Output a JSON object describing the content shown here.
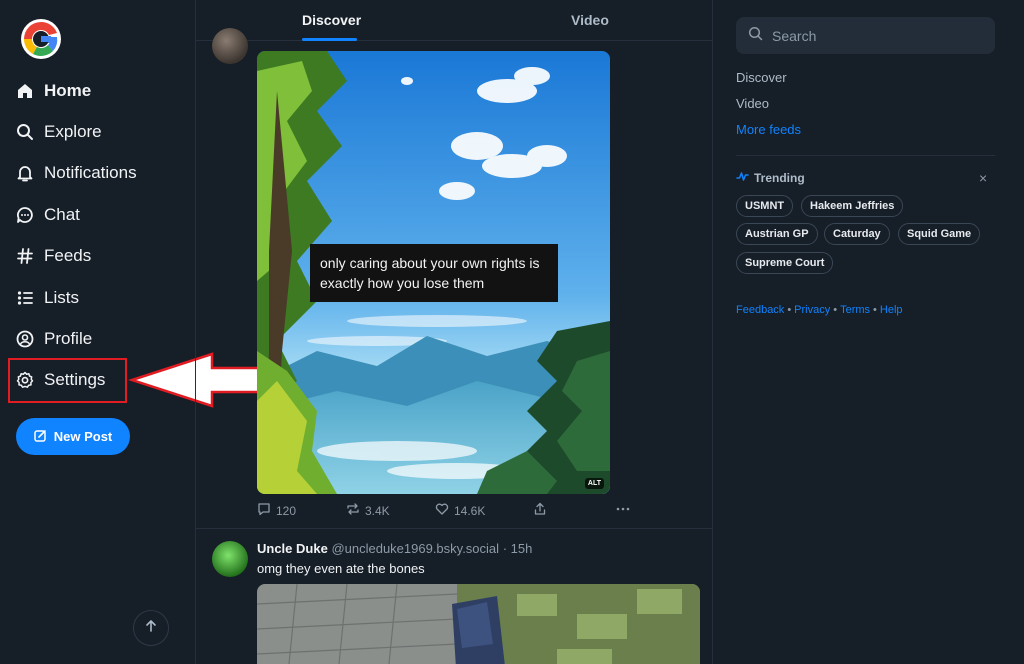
{
  "sidebar": {
    "nav": [
      {
        "label": "Home",
        "icon": "home-icon"
      },
      {
        "label": "Explore",
        "icon": "search-icon"
      },
      {
        "label": "Notifications",
        "icon": "bell-icon"
      },
      {
        "label": "Chat",
        "icon": "chat-bubble-icon"
      },
      {
        "label": "Feeds",
        "icon": "hash-icon"
      },
      {
        "label": "Lists",
        "icon": "list-icon"
      },
      {
        "label": "Profile",
        "icon": "user-circle-icon"
      },
      {
        "label": "Settings",
        "icon": "gear-icon"
      }
    ],
    "new_post_label": "New Post"
  },
  "feed": {
    "tabs": [
      "Discover",
      "Video"
    ],
    "active_tab": "Discover",
    "post1": {
      "image_caption": "only caring about your own rights is exactly how you lose them",
      "alt_badge": "ALT",
      "replies": "120",
      "reposts": "3.4K",
      "likes": "14.6K"
    },
    "post2": {
      "author": "Uncle Duke",
      "handle": "@uncleduke1969.bsky.social",
      "time": "15h",
      "separator": "·",
      "text": "omg they even ate the bones"
    }
  },
  "right": {
    "search_placeholder": "Search",
    "feed_links": [
      "Discover",
      "Video",
      "More feeds"
    ],
    "trending_title": "Trending",
    "trending_close": "×",
    "trending": [
      "USMNT",
      "Hakeem Jeffries",
      "Austrian GP",
      "Caturday",
      "Squid Game",
      "Supreme Court"
    ],
    "footer": [
      "Feedback",
      "Privacy",
      "Terms",
      "Help"
    ],
    "footer_separator": "•"
  },
  "colors": {
    "background": "#161e27",
    "accent": "#1083fe",
    "annotation": "#e11c22"
  }
}
